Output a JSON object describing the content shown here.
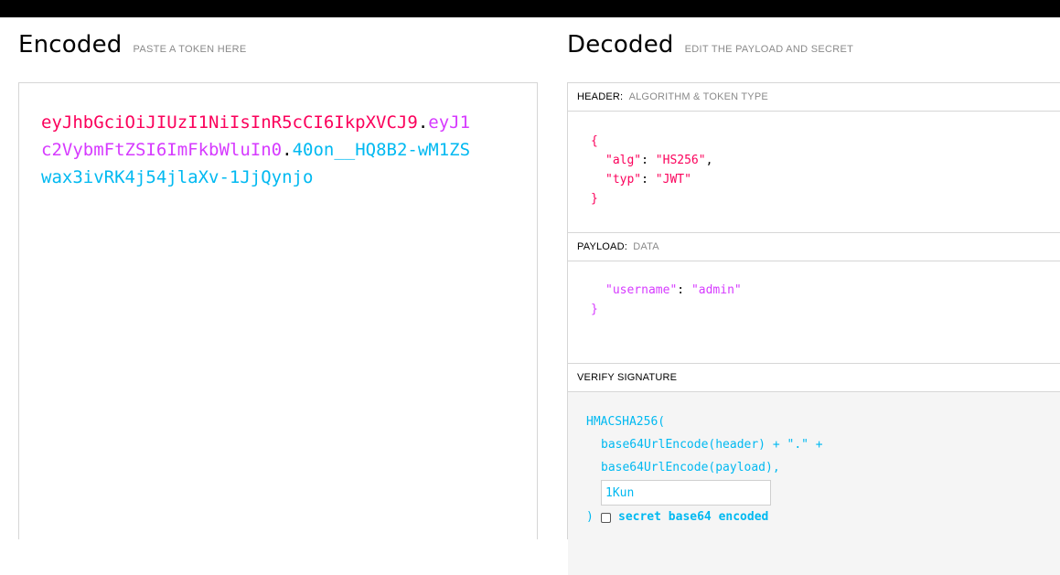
{
  "encoded": {
    "title": "Encoded",
    "subtitle": "PASTE A TOKEN HERE",
    "token": {
      "header": "eyJhbGciOiJIUzI1NiIsInR5cCI6IkpXVCJ9",
      "payload": "eyJ1c2VybmFtZSI6ImFkbWluIn0",
      "signature": "40on__HQ8B2-wM1ZSwax3ivRK4j54jlaXv-1JjQynjo",
      "dot": "."
    }
  },
  "decoded": {
    "title": "Decoded",
    "subtitle": "EDIT THE PAYLOAD AND SECRET",
    "header_section": {
      "label": "HEADER:",
      "sub": "ALGORITHM & TOKEN TYPE",
      "open_brace": "{",
      "close_brace": "}",
      "alg_key": "\"alg\"",
      "alg_value": "\"HS256\"",
      "typ_key": "\"typ\"",
      "typ_value": "\"JWT\""
    },
    "payload_section": {
      "label": "PAYLOAD:",
      "sub": "DATA",
      "username_key": "\"username\"",
      "username_value": "\"admin\"",
      "close_brace": "}"
    },
    "verify_section": {
      "label": "VERIFY SIGNATURE",
      "line1": "HMACSHA256(",
      "line2": "base64UrlEncode(header) + \".\" +",
      "line3": "base64UrlEncode(payload),",
      "secret_value": "1Kun",
      "close_paren": ")",
      "checkbox_label": "secret base64 encoded",
      "checkbox_checked": false
    }
  },
  "colors": {
    "header": "#fb015b",
    "payload": "#d63aff",
    "signature": "#00b9f1"
  }
}
